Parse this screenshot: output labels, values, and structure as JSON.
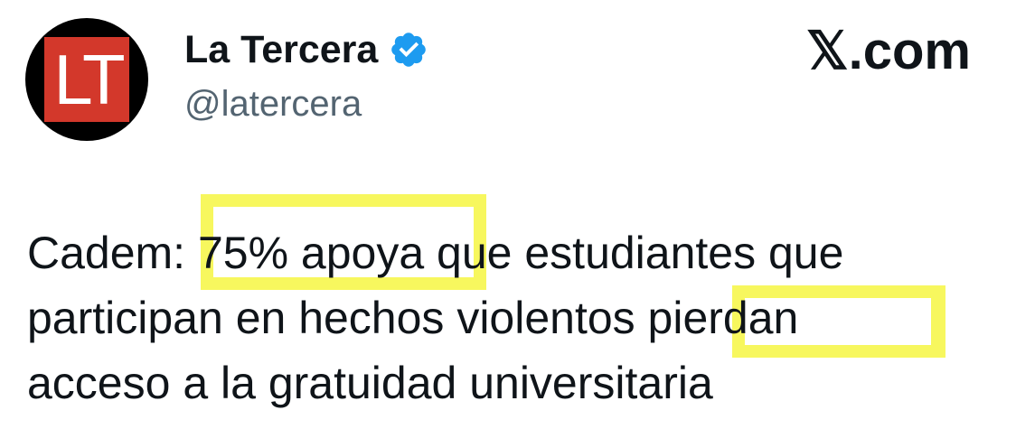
{
  "account": {
    "display_name": "La Tercera",
    "handle": "@latercera",
    "avatar_text": "LT",
    "verified_icon": "verified-badge-icon",
    "verified_color": "#1d9bf0"
  },
  "brand": {
    "label": "𝕏.com"
  },
  "tweet": {
    "lines": [
      "Cadem: 75% apoya que estudiantes que",
      "participan en hechos violentos pierdan",
      "acceso a la gratuidad universitaria"
    ],
    "highlights": [
      "75% apoya",
      "pierdan"
    ],
    "highlight_color": "#f7f75e"
  }
}
